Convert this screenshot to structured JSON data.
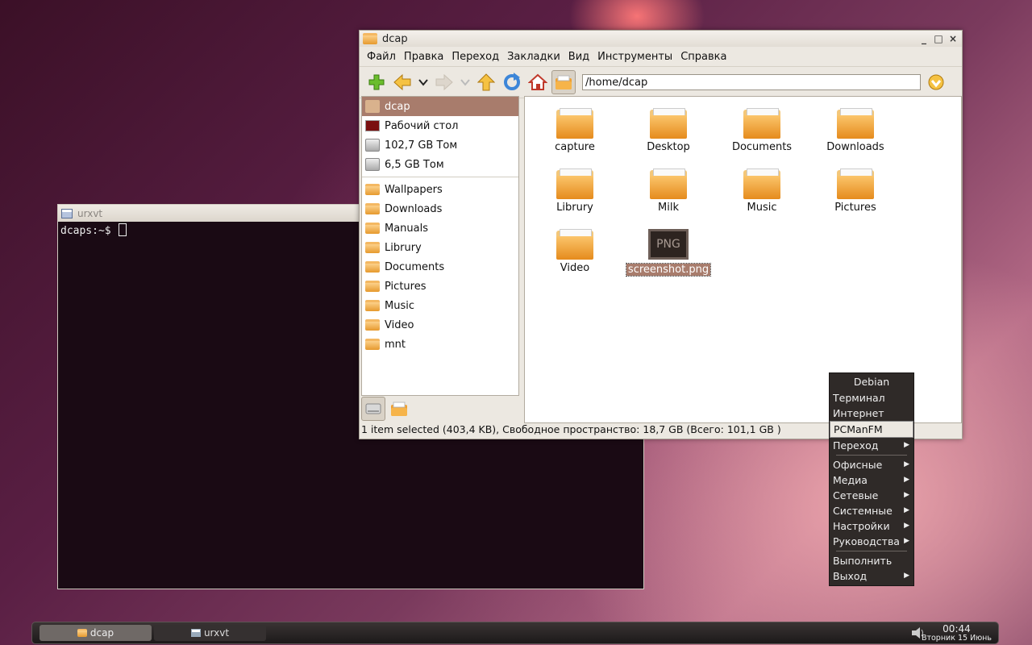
{
  "terminal": {
    "title": "urxvt",
    "prompt": "dcaps:~$"
  },
  "fm": {
    "title": "dcap",
    "menu": [
      "Файл",
      "Правка",
      "Переход",
      "Закладки",
      "Вид",
      "Инструменты",
      "Справка"
    ],
    "toolbar_icons": [
      "new-folder-icon",
      "back-icon",
      "history-dropdown-icon",
      "forward-icon",
      "forward-history-dropdown-icon",
      "up-icon",
      "reload-icon",
      "home-icon",
      "places-icon"
    ],
    "address": "/home/dcap",
    "sidebar": {
      "places": [
        {
          "label": "dcap",
          "icon": "home-icon",
          "selected": true
        },
        {
          "label": "Рабочий стол",
          "icon": "desktop-icon"
        },
        {
          "label": "102,7 GB Том",
          "icon": "drive-icon"
        },
        {
          "label": "6,5 GB Том",
          "icon": "drive-icon"
        }
      ],
      "bookmarks": [
        "Wallpapers",
        "Downloads",
        "Manuals",
        "Librury",
        "Documents",
        "Pictures",
        "Music",
        "Video",
        "mnt"
      ]
    },
    "files": [
      {
        "name": "capture",
        "type": "folder"
      },
      {
        "name": "Desktop",
        "type": "folder"
      },
      {
        "name": "Documents",
        "type": "folder"
      },
      {
        "name": "Downloads",
        "type": "folder"
      },
      {
        "name": "Librury",
        "type": "folder"
      },
      {
        "name": "Milk",
        "type": "folder"
      },
      {
        "name": "Music",
        "type": "folder"
      },
      {
        "name": "Pictures",
        "type": "folder"
      },
      {
        "name": "Video",
        "type": "folder"
      },
      {
        "name": "screenshot.png",
        "type": "png",
        "badge": "PNG",
        "selected": true
      }
    ],
    "status": "1 item selected (403,4 KB), Свободное пространство: 18,7 GB (Всего: 101,1 GB )"
  },
  "menu": {
    "header": "Debian",
    "items": [
      {
        "label": "Терминал"
      },
      {
        "label": "Интернет"
      },
      {
        "label": "PCManFM",
        "highlighted": true
      },
      {
        "label": "Переход",
        "submenu": true
      },
      {
        "sep": true
      },
      {
        "label": "Офисные",
        "submenu": true
      },
      {
        "label": "Медиа",
        "submenu": true
      },
      {
        "label": "Сетевые",
        "submenu": true
      },
      {
        "label": "Системные",
        "submenu": true
      },
      {
        "label": "Настройки",
        "submenu": true
      },
      {
        "label": "Руководства",
        "submenu": true
      },
      {
        "sep": true
      },
      {
        "label": "Выполнить"
      },
      {
        "label": "Выход",
        "submenu": true
      }
    ]
  },
  "taskbar": {
    "tasks": [
      {
        "label": "dcap",
        "active": true
      },
      {
        "label": "urxvt",
        "active": false
      }
    ],
    "time": "00:44",
    "date": "Вторник 15 Июнь"
  },
  "colors": {
    "selection": "#a87c6c",
    "folder": "#f0a030",
    "menu_bg": "#2f2a28"
  }
}
